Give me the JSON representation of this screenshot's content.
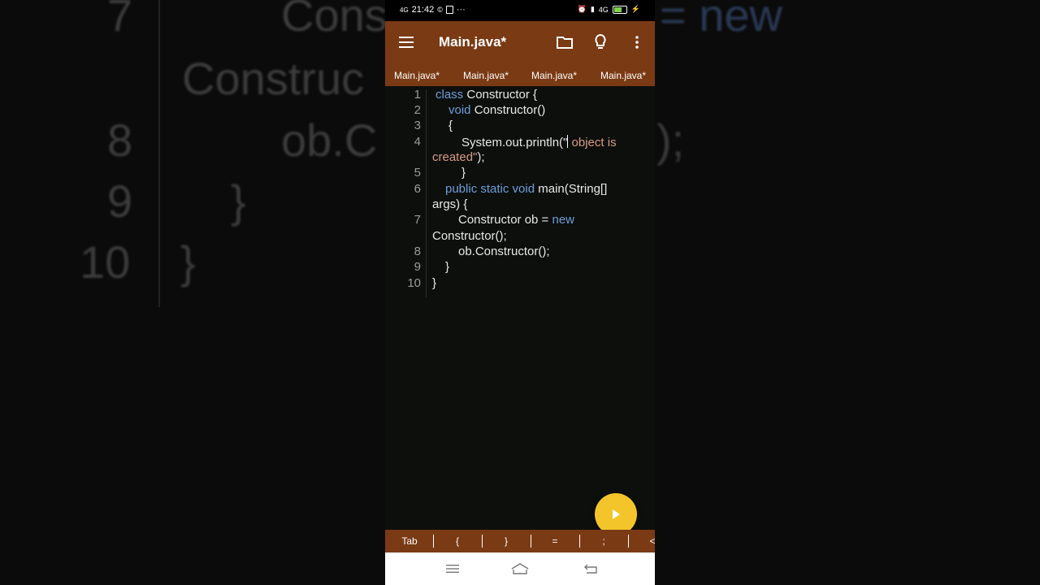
{
  "background": {
    "line_numbers": [
      "7",
      "8",
      "9",
      "10"
    ],
    "code_fragments": [
      "Cons",
      "Construc",
      "ob.C",
      "}",
      "}"
    ],
    "right_fragments": [
      "= new",
      ");"
    ]
  },
  "status_bar": {
    "network": "4G",
    "time": "21:42",
    "more": "···",
    "right_network": "4G",
    "colors": {
      "battery": "#7bd34a"
    }
  },
  "app_bar": {
    "title": "Main.java*",
    "menu_icon": "hamburger-menu-icon",
    "folder_icon": "folder-icon",
    "bulb_icon": "lightbulb-icon",
    "more_icon": "more-vertical-icon",
    "colors": {
      "primary": "#7a3a14"
    }
  },
  "tabs": [
    "Main.java*",
    "Main.java*",
    "Main.java*",
    "Main.java*"
  ],
  "editor": {
    "line_numbers": [
      "1",
      "2",
      "3",
      "4",
      "5",
      "6",
      "7",
      "8",
      "9",
      "10"
    ],
    "lines": {
      "l1_kw": "class",
      "l1_rest": " Constructor {",
      "l2_kw": "void",
      "l2_rest": " Constructor()",
      "l3": "{",
      "l4_code": "System.out.println(\"",
      "l4_str": " object is",
      "l4b_str": "created\"",
      "l4b_rest": ");",
      "l5": "}",
      "l6_kw": "public static void",
      "l6_rest": " main(String[]",
      "l6b": "args) {",
      "l7_code": "Constructor ob = ",
      "l7_kw": "new",
      "l7b": "Constructor();",
      "l8": "ob.Constructor();",
      "l9": "}",
      "l10": "}"
    },
    "colors": {
      "keyword": "#6e9ed8",
      "string": "#d89a86",
      "text": "#e8e8e8"
    }
  },
  "run_button": {
    "icon": "play-icon",
    "color": "#f3c52a"
  },
  "symbol_keys": [
    "Tab",
    "{",
    "}",
    "=",
    ";",
    "<"
  ],
  "nav_bar": {
    "icons": [
      "recent-apps-icon",
      "home-icon",
      "back-icon"
    ]
  }
}
